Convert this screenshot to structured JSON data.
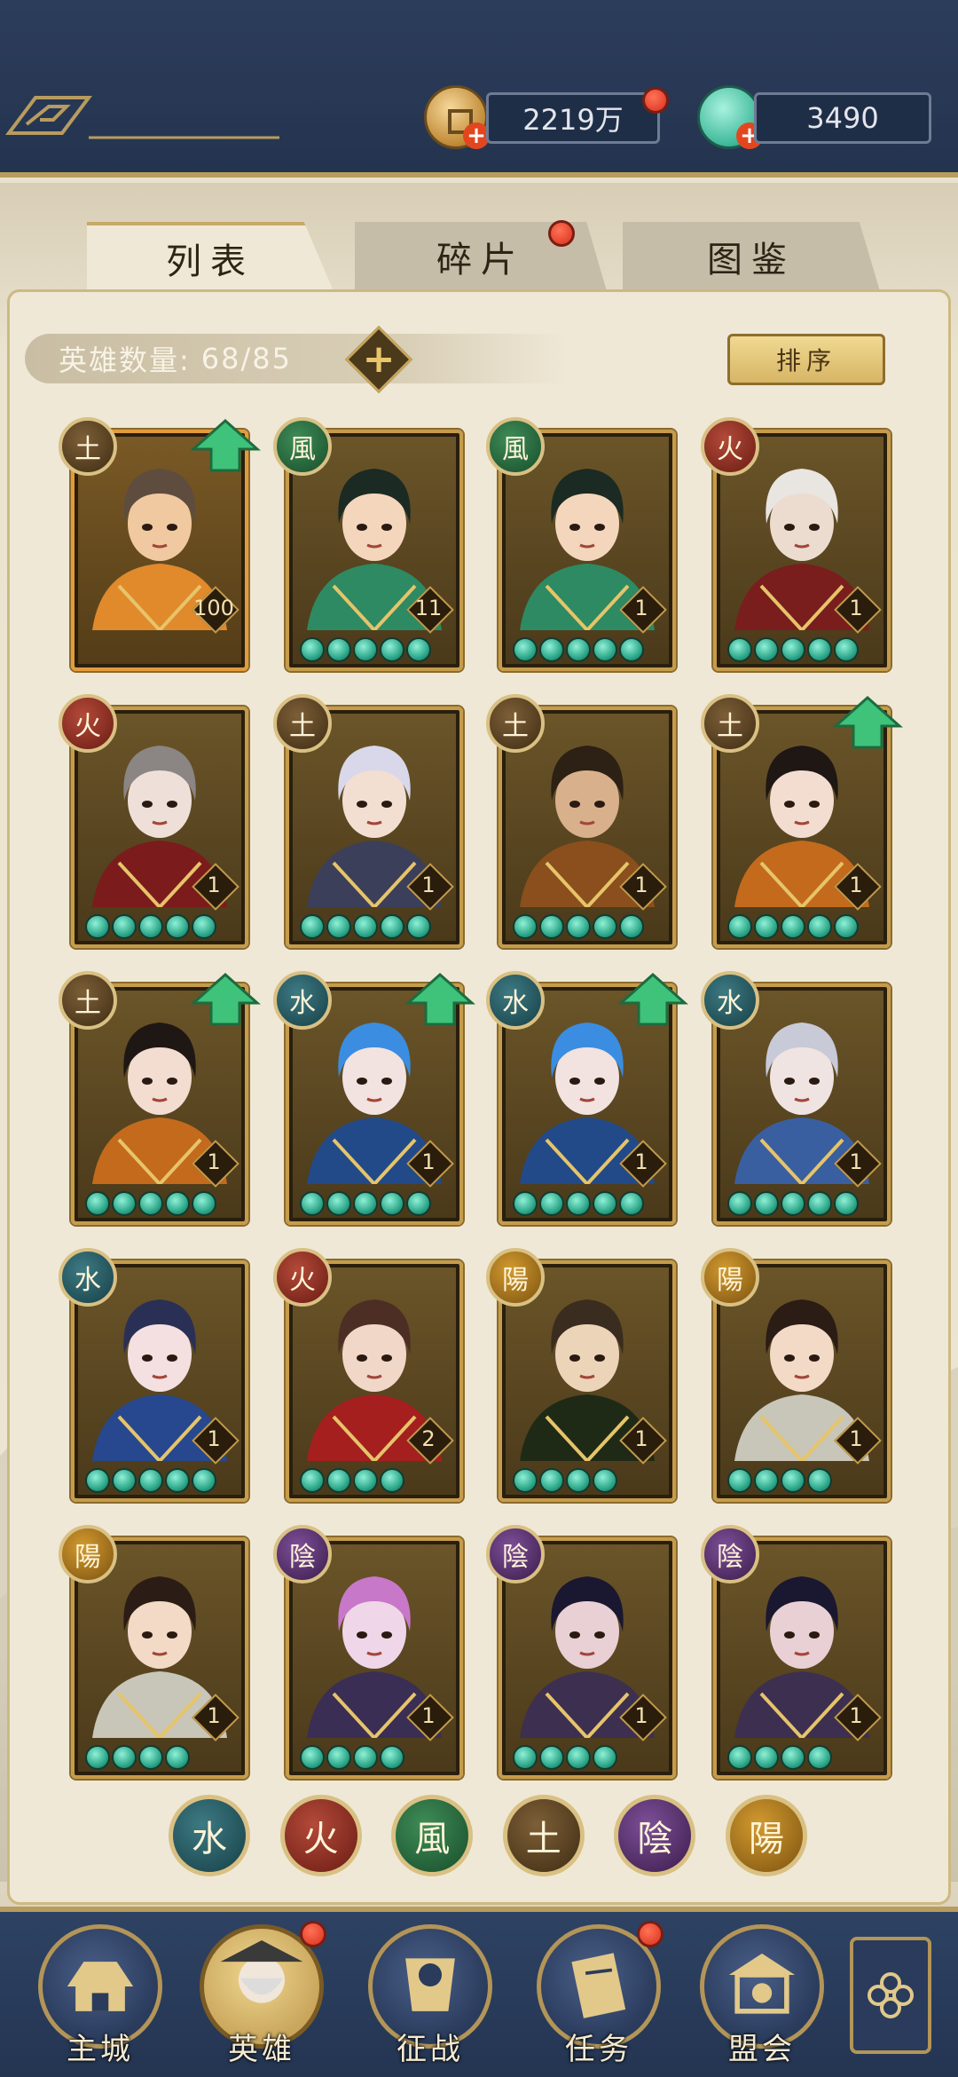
{
  "currency": {
    "coins": "2219万",
    "jade": "3490"
  },
  "tabs": [
    {
      "label": "列表",
      "active": true
    },
    {
      "label": "碎片",
      "active": false,
      "badge": true
    },
    {
      "label": "图鉴",
      "active": false
    }
  ],
  "roster": {
    "count_label": "英雄数量:",
    "count_value": "68/85"
  },
  "sort_label": "排序",
  "heroes": [
    {
      "element": "土",
      "level": "100",
      "stars": 0,
      "upgrade": true,
      "highlight": true
    },
    {
      "element": "風",
      "level": "11",
      "stars": 5,
      "upgrade": false
    },
    {
      "element": "風",
      "level": "1",
      "stars": 5,
      "upgrade": false
    },
    {
      "element": "火",
      "level": "1",
      "stars": 5,
      "upgrade": false
    },
    {
      "element": "火",
      "level": "1",
      "stars": 5,
      "upgrade": false
    },
    {
      "element": "土",
      "level": "1",
      "stars": 5,
      "upgrade": false
    },
    {
      "element": "土",
      "level": "1",
      "stars": 5,
      "upgrade": false
    },
    {
      "element": "土",
      "level": "1",
      "stars": 5,
      "upgrade": true
    },
    {
      "element": "土",
      "level": "1",
      "stars": 5,
      "upgrade": true
    },
    {
      "element": "水",
      "level": "1",
      "stars": 5,
      "upgrade": true
    },
    {
      "element": "水",
      "level": "1",
      "stars": 5,
      "upgrade": true
    },
    {
      "element": "水",
      "level": "1",
      "stars": 5,
      "upgrade": false
    },
    {
      "element": "水",
      "level": "1",
      "stars": 5,
      "upgrade": false
    },
    {
      "element": "火",
      "level": "2",
      "stars": 4,
      "upgrade": false
    },
    {
      "element": "陽",
      "level": "1",
      "stars": 4,
      "upgrade": false
    },
    {
      "element": "陽",
      "level": "1",
      "stars": 4,
      "upgrade": false
    },
    {
      "element": "陽",
      "level": "1",
      "stars": 4,
      "upgrade": false
    },
    {
      "element": "陰",
      "level": "1",
      "stars": 4,
      "upgrade": false
    },
    {
      "element": "陰",
      "level": "1",
      "stars": 4,
      "upgrade": false
    },
    {
      "element": "陰",
      "level": "1",
      "stars": 4,
      "upgrade": false
    }
  ],
  "element_filters": [
    "水",
    "火",
    "風",
    "土",
    "陰",
    "陽"
  ],
  "nav": [
    {
      "label": "主城",
      "active": false,
      "badge": false
    },
    {
      "label": "英雄",
      "active": true,
      "badge": true
    },
    {
      "label": "征战",
      "active": false,
      "badge": false
    },
    {
      "label": "任务",
      "active": false,
      "badge": true
    },
    {
      "label": "盟会",
      "active": false,
      "badge": false
    }
  ],
  "colors": {
    "top_bar": "#2c3d5c",
    "panel": "#efe8d6",
    "gold_trim": "#c59c4c",
    "jade_star": "#2fa88a",
    "badge_red": "#d8301d"
  }
}
